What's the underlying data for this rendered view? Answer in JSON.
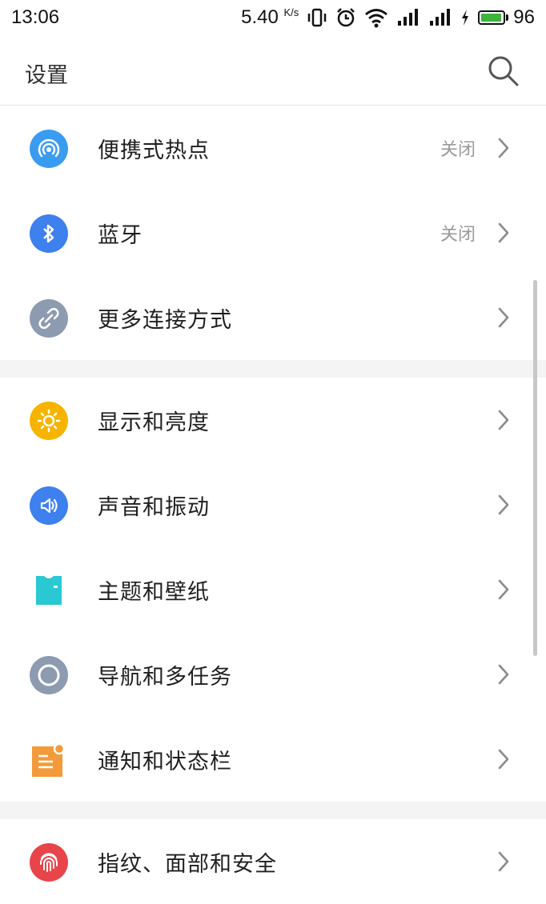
{
  "status_bar": {
    "time": "13:06",
    "speed_value": "5.40",
    "speed_unit": "K/s",
    "battery_level": "96",
    "battery_fraction": 0.96,
    "battery_color": "#3db43d"
  },
  "header": {
    "title": "设置"
  },
  "groups": [
    {
      "items": [
        {
          "label": "便携式热点",
          "status": "关闭",
          "icon": "hotspot-icon",
          "color": "#3a9cf0"
        },
        {
          "label": "蓝牙",
          "status": "关闭",
          "icon": "bluetooth-icon",
          "color": "#3d80ee"
        },
        {
          "label": "更多连接方式",
          "status": "",
          "icon": "link-icon",
          "color": "#8d9bb0"
        }
      ]
    },
    {
      "items": [
        {
          "label": "显示和亮度",
          "status": "",
          "icon": "sun-icon",
          "color": "#f6b400"
        },
        {
          "label": "声音和振动",
          "status": "",
          "icon": "speaker-icon",
          "color": "#3d80ee"
        },
        {
          "label": "主题和壁纸",
          "status": "",
          "icon": "tshirt-icon",
          "color": "#29c8d3"
        },
        {
          "label": "导航和多任务",
          "status": "",
          "icon": "navigation-ring-icon",
          "color": "#8d9bb0"
        },
        {
          "label": "通知和状态栏",
          "status": "",
          "icon": "notification-icon",
          "color": "#f39a3a"
        }
      ]
    },
    {
      "items": [
        {
          "label": "指纹、面部和安全",
          "status": "",
          "icon": "fingerprint-icon",
          "color": "#e8454a"
        }
      ]
    }
  ]
}
